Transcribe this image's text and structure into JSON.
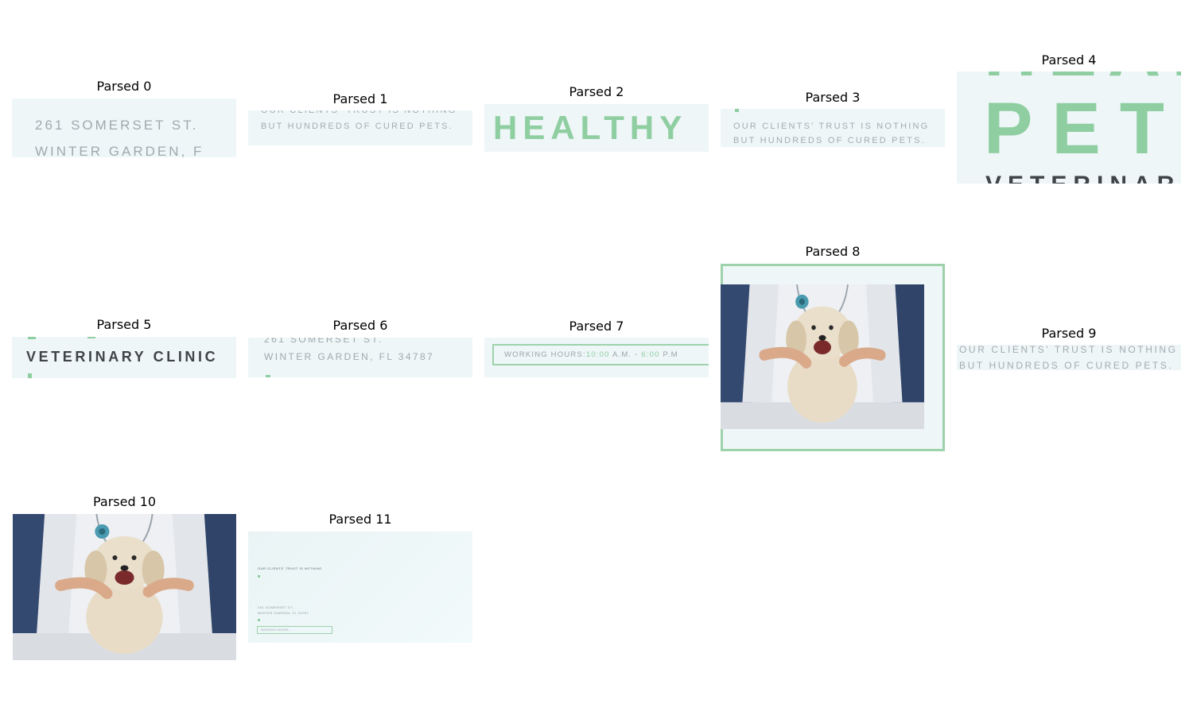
{
  "captions": [
    "Parsed 0",
    "Parsed 1",
    "Parsed 2",
    "Parsed 3",
    "Parsed 4",
    "Parsed 5",
    "Parsed 6",
    "Parsed 7",
    "Parsed 8",
    "Parsed 9",
    "Parsed 10",
    "Parsed 11"
  ],
  "address": {
    "line1": "261 SOMERSET ST.",
    "line2": "WINTER GARDEN, FL 34787",
    "line2_cropped": "WINTER GARDEN, F"
  },
  "trust": {
    "line1": "OUR CLIENTS' TRUST IS NOTHING",
    "line2": "BUT HUNDREDS OF CURED PETS."
  },
  "headline": {
    "word1": "HEALTHY",
    "word2": "PET",
    "word3": "VETERINARY CLINIC",
    "word3_cropped": "VETERINAR"
  },
  "hours": {
    "label": "WORKING HOURS:",
    "open": "10:00",
    "open_suffix": " A.M. - ",
    "close": "6:00",
    "close_suffix": " P.M"
  },
  "colors": {
    "accent": "#8fcea1",
    "panel_bg": "#eef6f8",
    "muted_text": "#9fa9ad",
    "dark_text": "#3e4448"
  }
}
